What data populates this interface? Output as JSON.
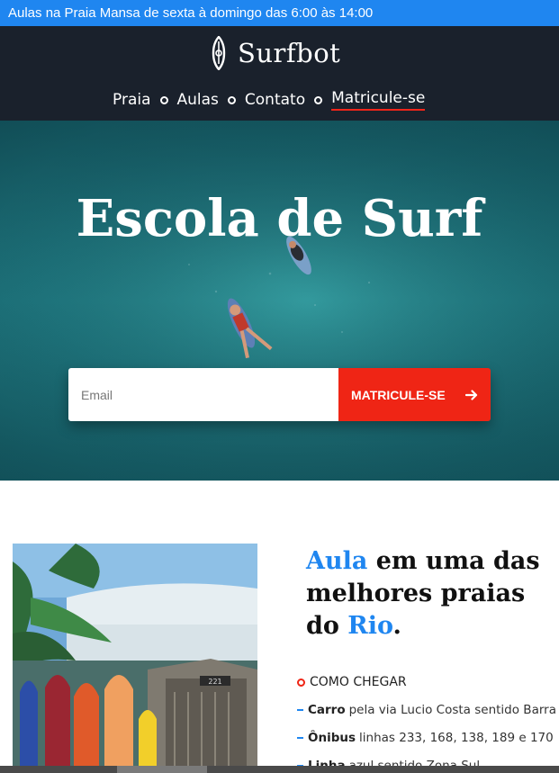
{
  "announcement": "Aulas na Praia Mansa de sexta à domingo das 6:00 às 14:00",
  "brand": {
    "name": "Surfbot"
  },
  "nav": {
    "items": [
      "Praia",
      "Aulas",
      "Contato",
      "Matricule-se"
    ],
    "active": "Matricule-se"
  },
  "hero": {
    "title": "Escola de Surf",
    "email_placeholder": "Email",
    "cta_label": "MATRICULE-SE"
  },
  "photo": {
    "sign_number": "221"
  },
  "section": {
    "title_highlight_1": "Aula",
    "title_mid": " em uma das melhores praias do ",
    "title_highlight_2": "Rio",
    "title_end": "."
  },
  "howto": {
    "heading": "COMO CHEGAR",
    "items": [
      {
        "label": "Carro",
        "text": "pela via Lucio Costa sentido Barra"
      },
      {
        "label": "Ônibus",
        "text": "linhas 233, 168, 138, 189 e 170"
      },
      {
        "label": "Linha",
        "text": "azul sentido Zona Sul"
      }
    ]
  },
  "colors": {
    "accent_blue": "#1f86f0",
    "accent_red": "#ef2515",
    "header_bg": "#1a212c"
  }
}
